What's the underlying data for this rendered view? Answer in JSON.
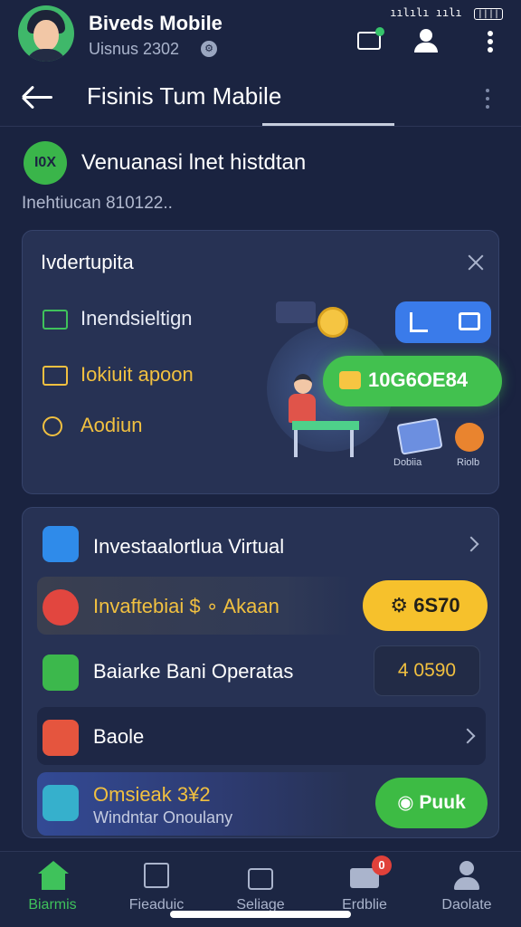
{
  "header": {
    "app_title": "Biveds Mobile",
    "app_subtitle": "Uisnus 2302",
    "status_bar": "ıılılı ıılı",
    "battery": "||||"
  },
  "nav": {
    "title": "Fisinis Tum Mabile"
  },
  "section": {
    "badge": "I0X",
    "title": "Venuanasi lnet histdtan",
    "subtitle": "Inehtiucan 810122.."
  },
  "card_overview": {
    "title": "Ivdertupita",
    "features": [
      {
        "label": "Inendsieltign",
        "icon": "grid-icon"
      },
      {
        "label": "Iokiuit apoon",
        "icon": "layout-icon"
      },
      {
        "label": "Aodiun",
        "icon": "pin-icon"
      }
    ],
    "illustration": {
      "balance_value": "10G6OE84",
      "caption_left": "Dobiia",
      "caption_right": "Riolb"
    }
  },
  "card_actions": {
    "rows": [
      {
        "label": "Investaalortlua Virtual"
      },
      {
        "label": "Invaftebiai $ ∘ Akaan",
        "button": "6S70"
      },
      {
        "label": "Baiarke Bani Operatas",
        "button": "4 0590"
      },
      {
        "label": "Baole"
      },
      {
        "label": "Omsieak 3¥2",
        "sublabel": "Windntar Onoulany",
        "button": "Puuk"
      }
    ]
  },
  "tabbar": {
    "tabs": [
      {
        "label": "Biarmis",
        "active": true
      },
      {
        "label": "Fieaduic",
        "active": false
      },
      {
        "label": "Seliage",
        "active": false
      },
      {
        "label": "Erdblie",
        "active": false,
        "badge": "0"
      },
      {
        "label": "Daolate",
        "active": false
      }
    ]
  },
  "colors": {
    "background": "#1a2340",
    "card": "#273254",
    "accent_green": "#3fc25b",
    "accent_yellow": "#f6c12c",
    "accent_blue": "#3a7bea"
  }
}
